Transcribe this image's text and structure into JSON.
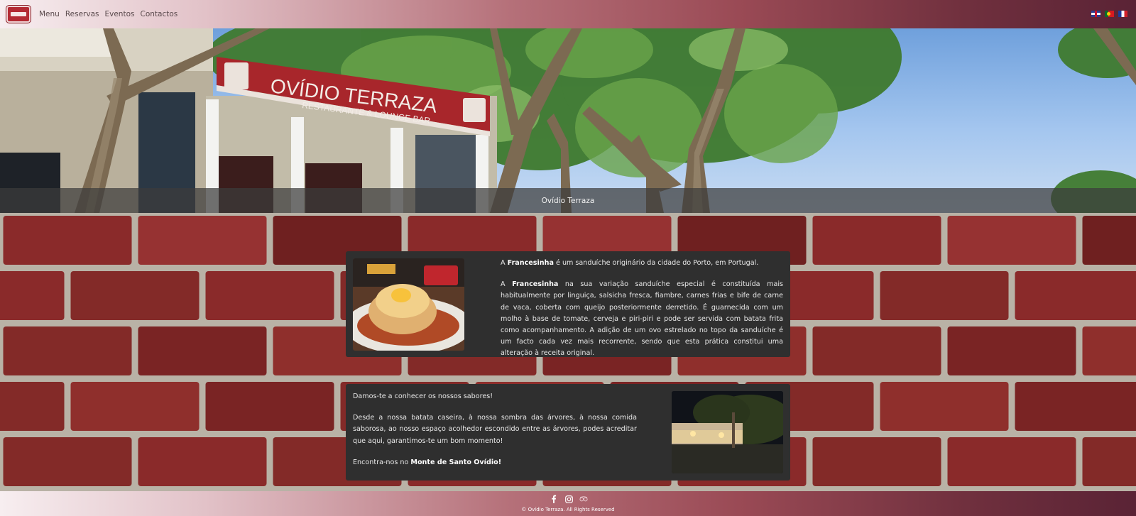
{
  "navbar": {
    "logo_text": "Ovídio Terraza",
    "links": [
      "Menu",
      "Reservas",
      "Eventos",
      "Contactos"
    ],
    "languages": [
      "English",
      "Português",
      "Français"
    ]
  },
  "hero": {
    "sign_title": "OVÍDIO TERRAZA",
    "sign_subtitle": "RESTAURANTE & LOUNGE BAR",
    "caption": "Ovídio Terraza"
  },
  "card1": {
    "p1_prefix": "A ",
    "p1_bold": "Francesinha",
    "p1_rest": " é um sanduíche originário da cidade do Porto, em Portugal.",
    "p2_prefix": "A ",
    "p2_bold": "Francesinha",
    "p2_rest": " na sua variação sanduíche especial é constituída mais habitualmente por linguiça, salsicha fresca, fiambre, carnes frias e bife de carne de vaca, coberta com queijo posteriormente derretido. É guarnecida com um molho à base de tomate, cerveja e piri-piri e pode ser servida com batata frita como acompanhamento. A adição de um ovo estrelado no topo da sanduíche é um facto cada vez mais recorrente, sendo que esta prática constitui uma alteração à receita original.",
    "image_label": "OVÍDIO TERRAZA"
  },
  "card2": {
    "p1": "Damos-te a conhecer os nossos sabores!",
    "p2": "Desde a nossa batata caseira, à nossa sombra das árvores, à nossa comida saborosa, ao nosso espaço acolhedor escondido entre as árvores, podes acreditar que aqui, garantimos-te um bom momento!",
    "p3_prefix": "Encontra-nos no ",
    "p3_bold": "Monte de Santo Ovídio!"
  },
  "footer": {
    "social": [
      "facebook-icon",
      "instagram-icon",
      "tripadvisor-icon"
    ],
    "copyright": "© Ovídio Terraza. All Rights Reserved"
  },
  "colors": {
    "nav_gradient_start": "#f7eef0",
    "nav_gradient_end": "#5a2335",
    "card_bg": "#2f2f2f",
    "sign_red": "#a8262b"
  }
}
